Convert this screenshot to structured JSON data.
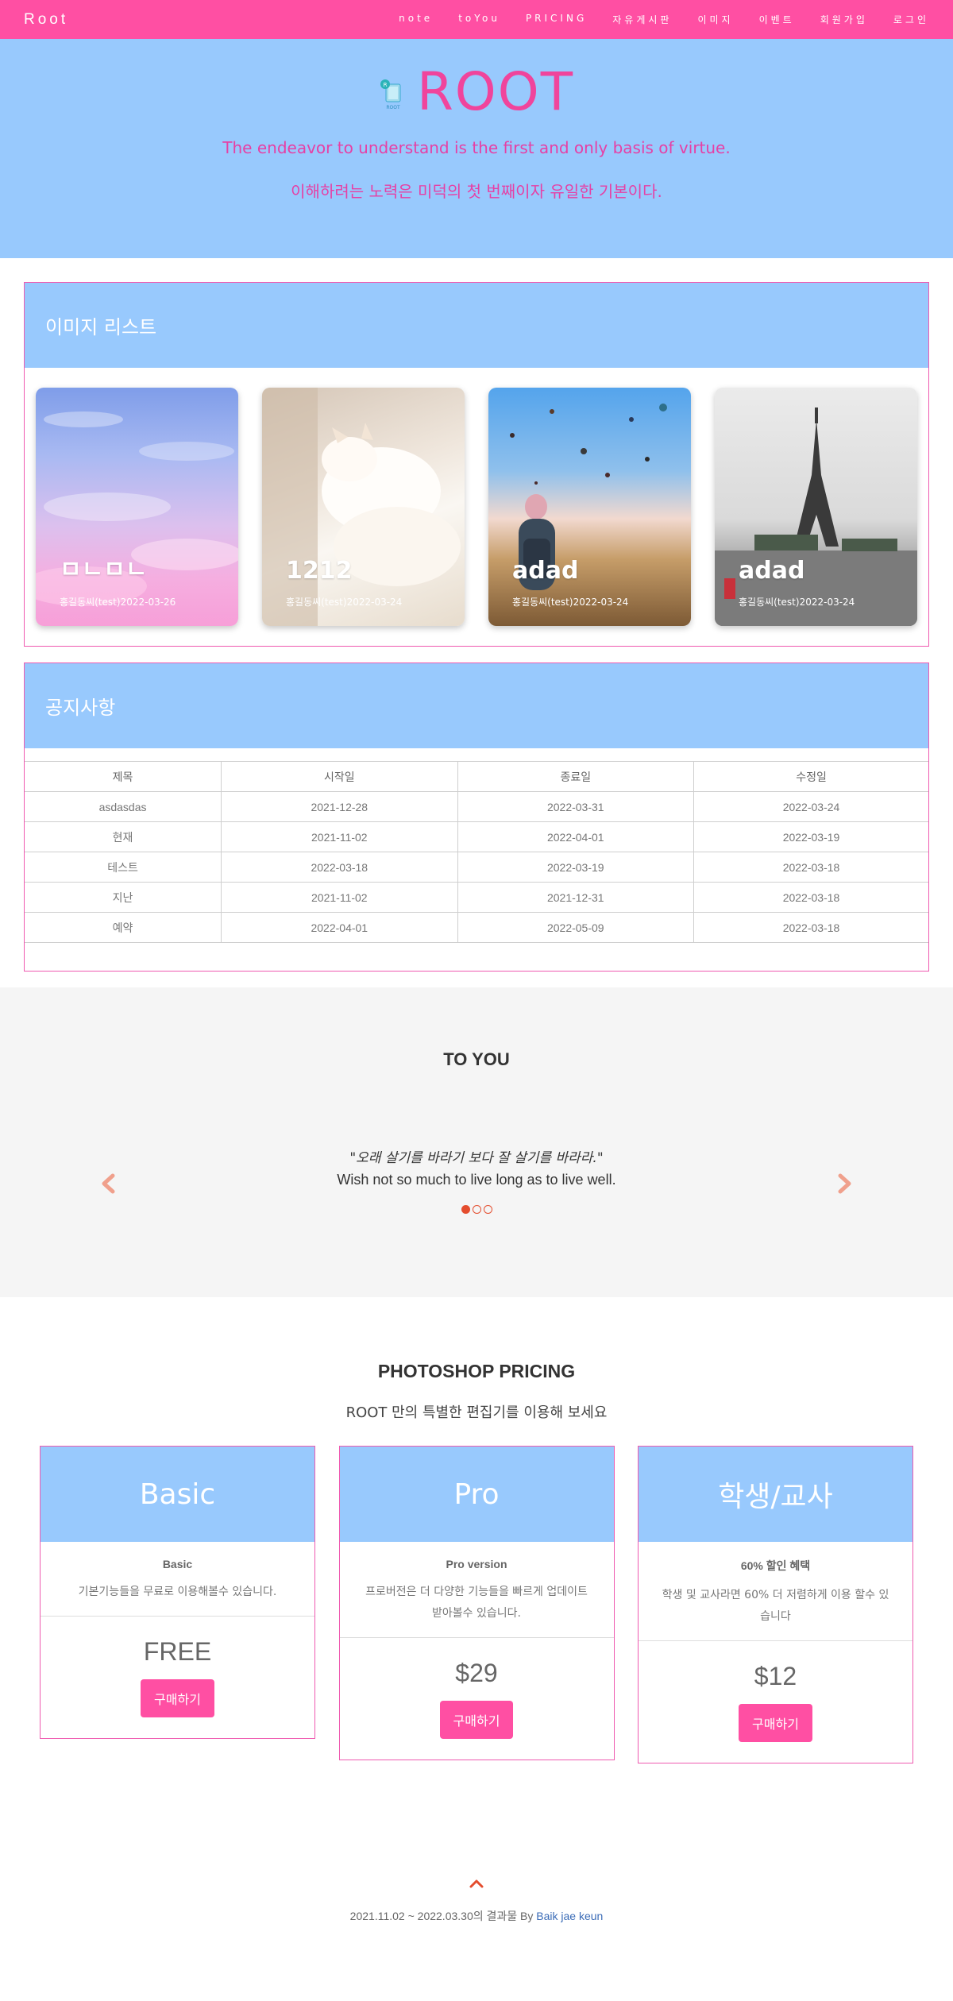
{
  "nav": {
    "brand": "Root",
    "links": [
      "note",
      "toYou",
      "PRICING",
      "자유게시판",
      "이미지",
      "이벤트",
      "회원가입",
      "로그인"
    ]
  },
  "hero": {
    "title": "ROOT",
    "logo_text": "ROOT",
    "line_en": "The endeavor to understand is the first and only basis of virtue.",
    "line_ko": "이해하려는 노력은 미덕의 첫 번째이자 유일한 기본이다."
  },
  "images": {
    "heading": "이미지 리스트",
    "cards": [
      {
        "title": "ㅁㄴㅁㄴ",
        "meta": "홍길동씨(test)2022-03-26"
      },
      {
        "title": "1212",
        "meta": "홍길동씨(test)2022-03-24"
      },
      {
        "title": "adad",
        "meta": "홍길동씨(test)2022-03-24"
      },
      {
        "title": "adad",
        "meta": "홍길동씨(test)2022-03-24"
      }
    ]
  },
  "notice": {
    "heading": "공지사항",
    "columns": [
      "제목",
      "시작일",
      "종료일",
      "수정일"
    ],
    "rows": [
      [
        "asdasdas",
        "2021-12-28",
        "2022-03-31",
        "2022-03-24"
      ],
      [
        "현재",
        "2021-11-02",
        "2022-04-01",
        "2022-03-19"
      ],
      [
        "테스트",
        "2022-03-18",
        "2022-03-19",
        "2022-03-18"
      ],
      [
        "지난",
        "2021-11-02",
        "2021-12-31",
        "2022-03-18"
      ],
      [
        "예약",
        "2022-04-01",
        "2022-05-09",
        "2022-03-18"
      ]
    ]
  },
  "toyou": {
    "heading": "TO YOU",
    "quote_ko": "\"오래 살기를 바라기 보다 잘 살기를 바라라.\"",
    "quote_en": "Wish not so much to live long as to live well.",
    "slide_count": 3,
    "active_slide": 1
  },
  "pricing": {
    "heading": "PHOTOSHOP PRICING",
    "tagline": "ROOT 만의 특별한 편집기를 이용해 보세요",
    "plans": [
      {
        "name": "Basic",
        "subtitle": "Basic",
        "desc": "기본기능들을 무료로 이용해볼수 있습니다.",
        "price": "FREE",
        "button": "구매하기"
      },
      {
        "name": "Pro",
        "subtitle": "Pro version",
        "desc": "프로버전은 더 다양한 기능들을 빠르게 업데이트 받아볼수 있습니다.",
        "price": "$29",
        "button": "구매하기"
      },
      {
        "name": "학생/교사",
        "subtitle": "60% 할인 혜택",
        "desc": "학생 및 교사라면 60% 더 저렴하게 이용 할수 있습니다",
        "price": "$12",
        "button": "구매하기"
      }
    ]
  },
  "footer": {
    "text": "2021.11.02 ~ 2022.03.30의 결과물 By ",
    "author": "Baik jae keun"
  },
  "colors": {
    "nav_pink": "#ff4fa3",
    "hero_blue": "#98c9fd",
    "accent_pink": "#f0449c",
    "carousel_orange": "#e44d2e",
    "link_blue": "#3b6cb7"
  },
  "icons": [
    "chevron-left-icon",
    "chevron-right-icon",
    "chevron-up-icon",
    "root-logo-icon"
  ]
}
